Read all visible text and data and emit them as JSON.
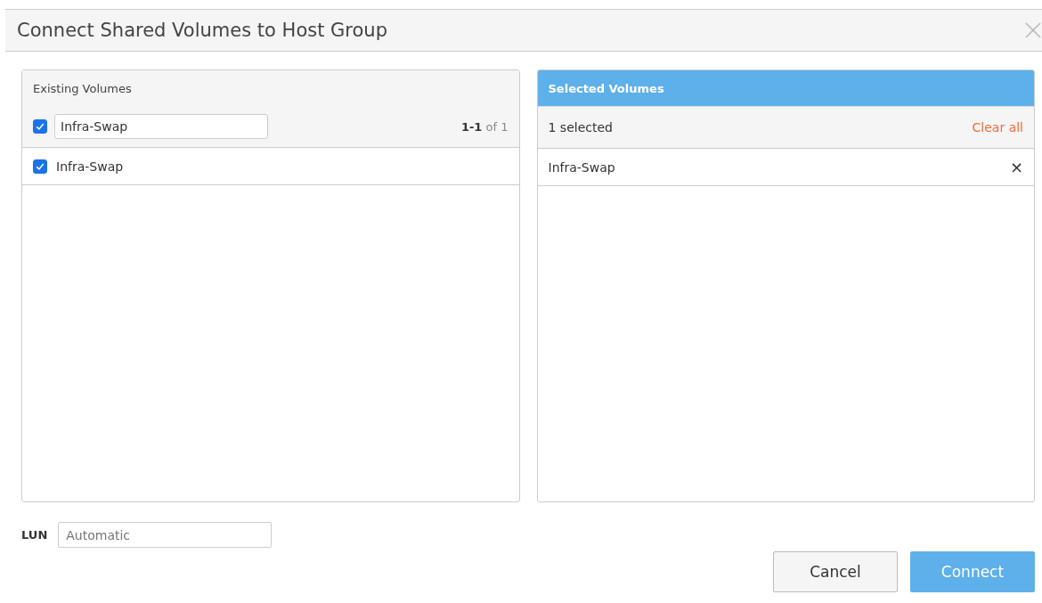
{
  "dialog": {
    "title": "Connect Shared Volumes to Host Group"
  },
  "existing_volumes": {
    "title": "Existing Volumes",
    "select_all_checked": true,
    "filter": {
      "value": "Infra-Swap"
    },
    "range": "**1-1** of 1",
    "items": [
      {
        "name": "Infra-Swap",
        "checked": true
      }
    ]
  },
  "selected_volumes": {
    "title": "Selected Volumes",
    "summary": "1 selected",
    "clear_link": "Clear all",
    "items": [
      {
        "name": "Infra-Swap",
        "remove": "×"
      }
    ]
  },
  "lun": {
    "label": "LUN",
    "placeholder": "Automatic"
  },
  "buttons": [
    {
      "label": "Cancel",
      "kind": "secondary"
    },
    {
      "label": "Connect",
      "kind": "primary"
    }
  ]
}
